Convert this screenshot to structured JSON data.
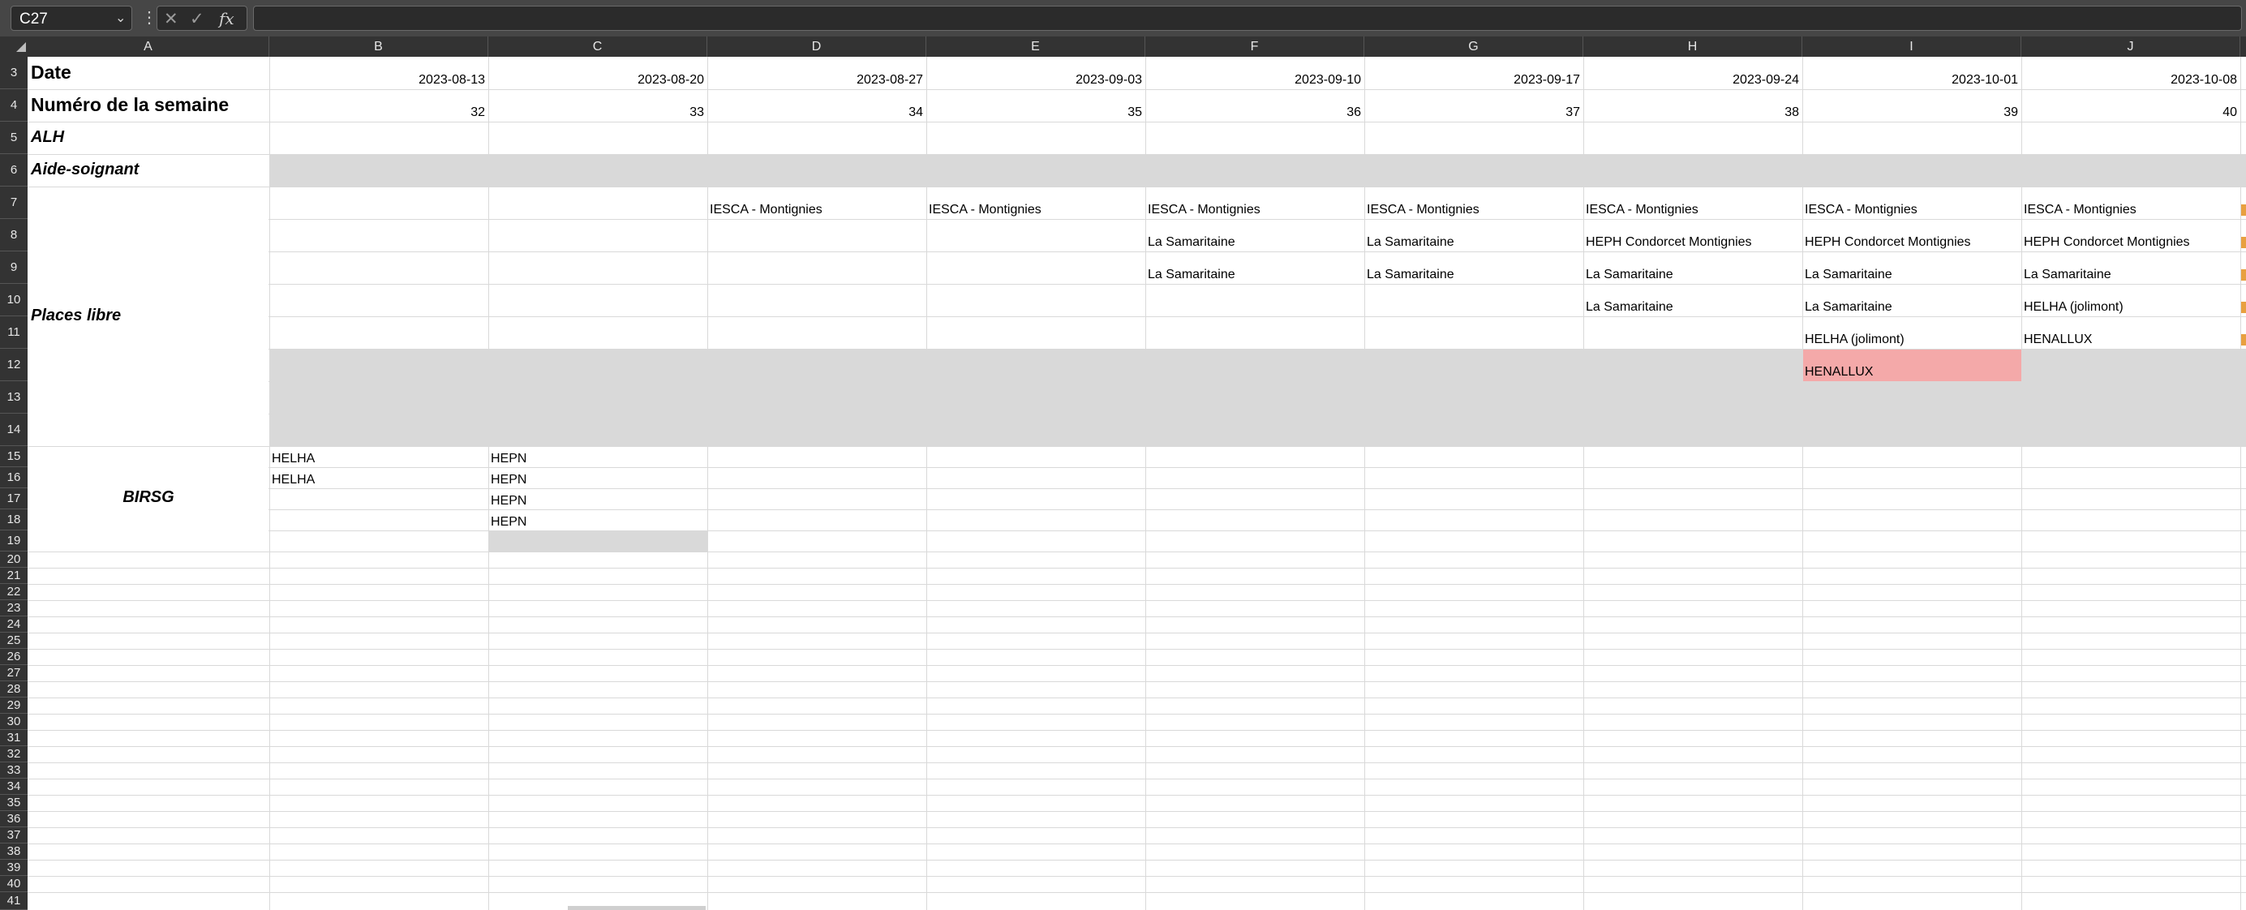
{
  "formula_bar": {
    "name_box": "C27",
    "formula": "",
    "fx_label": "fx"
  },
  "columns": [
    "A",
    "B",
    "C",
    "D",
    "E",
    "F",
    "G",
    "H",
    "I",
    "J"
  ],
  "rows": [
    "3",
    "4",
    "5",
    "6",
    "7",
    "8",
    "9",
    "10",
    "11",
    "12",
    "13",
    "14",
    "15",
    "16",
    "17",
    "18",
    "19",
    "20",
    "21",
    "22",
    "23",
    "24",
    "25",
    "26",
    "27",
    "28",
    "29",
    "30",
    "31",
    "32",
    "33",
    "34",
    "35",
    "36",
    "37",
    "38",
    "39",
    "40",
    "41"
  ],
  "labels": {
    "date": "Date",
    "week": "Numéro de la semaine",
    "alh": "ALH",
    "aide": "Aide-soignant",
    "places": "Places libre",
    "birsg": "BIRSG"
  },
  "dates": [
    "2023-08-13",
    "2023-08-20",
    "2023-08-27",
    "2023-09-03",
    "2023-09-10",
    "2023-09-17",
    "2023-09-24",
    "2023-10-01",
    "2023-10-08"
  ],
  "weeks": [
    "32",
    "33",
    "34",
    "35",
    "36",
    "37",
    "38",
    "39",
    "40"
  ],
  "places": {
    "D7": "IESCA - Montignies",
    "E7": "IESCA - Montignies",
    "F7": "IESCA - Montignies",
    "G7": "IESCA - Montignies",
    "H7": "IESCA - Montignies",
    "I7": "IESCA - Montignies",
    "J7": "IESCA - Montignies",
    "F8": "La Samaritaine",
    "G8": "La Samaritaine",
    "H8": "HEPH Condorcet Montignies",
    "I8": "HEPH Condorcet Montignies",
    "J8": "HEPH Condorcet Montignies",
    "F9": "La Samaritaine",
    "G9": "La Samaritaine",
    "H9": "La Samaritaine",
    "I9": "La Samaritaine",
    "J9": "La Samaritaine",
    "H10": "La Samaritaine",
    "I10": "La Samaritaine",
    "J10": "HELHA (jolimont)",
    "I11": "HELHA (jolimont)",
    "J11": "HENALLUX",
    "I12": "HENALLUX"
  },
  "birsg": {
    "B15": "HELHA",
    "B16": "HELHA",
    "C15": "HEPN",
    "C16": "HEPN",
    "C17": "HEPN",
    "C18": "HEPN"
  },
  "colors": {
    "header_bg": "#333333",
    "formula_bar_bg": "#464646",
    "gray_fill": "#d9d9d9",
    "pink_fill": "#f4a9a9"
  }
}
